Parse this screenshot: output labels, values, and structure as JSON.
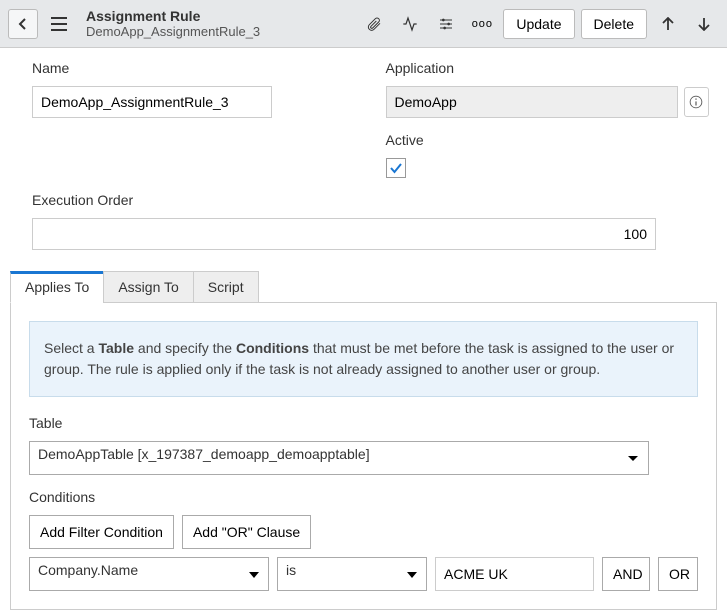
{
  "header": {
    "title": "Assignment Rule",
    "subtitle": "DemoApp_AssignmentRule_3",
    "update_label": "Update",
    "delete_label": "Delete",
    "more_label": "ooo"
  },
  "form": {
    "name_label": "Name",
    "name_value": "DemoApp_AssignmentRule_3",
    "application_label": "Application",
    "application_value": "DemoApp",
    "active_label": "Active",
    "active_checked": true,
    "execution_order_label": "Execution Order",
    "execution_order_value": "100"
  },
  "tabs": [
    {
      "label": "Applies To",
      "active": true
    },
    {
      "label": "Assign To",
      "active": false
    },
    {
      "label": "Script",
      "active": false
    }
  ],
  "applies_to": {
    "info_prefix": "Select a ",
    "info_bold1": "Table",
    "info_mid": " and specify the ",
    "info_bold2": "Conditions",
    "info_suffix": " that must be met before the task is assigned to the user or group. The rule is applied only if the task is not already assigned to another user or group.",
    "table_label": "Table",
    "table_value": "DemoAppTable [x_197387_demoapp_demoapptable]",
    "conditions_label": "Conditions",
    "add_filter_label": "Add Filter Condition",
    "add_or_label": "Add \"OR\" Clause",
    "cond_field": "Company.Name",
    "cond_op": "is",
    "cond_value": "ACME UK",
    "and_label": "AND",
    "or_label": "OR"
  }
}
